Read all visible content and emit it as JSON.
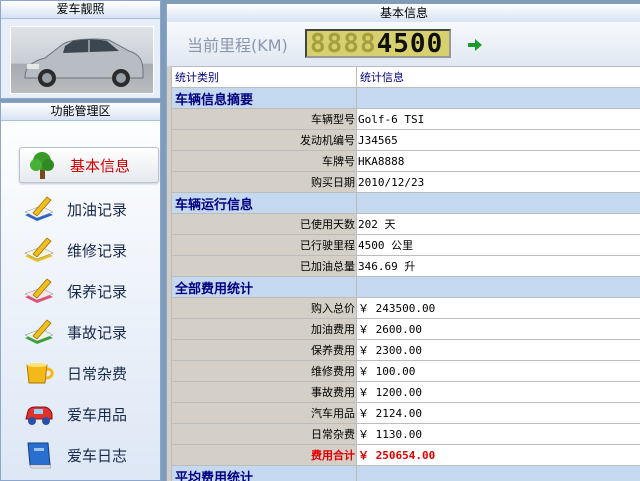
{
  "sidebar": {
    "car_title": "爱车靓照",
    "func_title": "功能管理区",
    "items": [
      {
        "label": "基本信息",
        "icon": "tree-icon",
        "active": true
      },
      {
        "label": "加油记录",
        "icon": "notepad-pen-icon"
      },
      {
        "label": "维修记录",
        "icon": "notepad-pen-icon"
      },
      {
        "label": "保养记录",
        "icon": "notepad-pen-icon"
      },
      {
        "label": "事故记录",
        "icon": "notepad-pen-icon"
      },
      {
        "label": "日常杂费",
        "icon": "cup-icon"
      },
      {
        "label": "爱车用品",
        "icon": "toy-car-icon"
      },
      {
        "label": "爱车日志",
        "icon": "book-icon"
      }
    ]
  },
  "main": {
    "title": "基本信息",
    "odometer_label": "当前里程(KM)",
    "odometer_ghost": "8888",
    "odometer_value": "4500",
    "columns": [
      "统计类别",
      "统计信息"
    ],
    "sections": [
      {
        "title": "车辆信息摘要",
        "rows": [
          {
            "k": "车辆型号",
            "v": "Golf-6 TSI"
          },
          {
            "k": "发动机编号",
            "v": "J34565"
          },
          {
            "k": "车牌号",
            "v": "HKA8888"
          },
          {
            "k": "购买日期",
            "v": "2010/12/23"
          }
        ]
      },
      {
        "title": "车辆运行信息",
        "rows": [
          {
            "k": "已使用天数",
            "v": "202 天"
          },
          {
            "k": "已行驶里程",
            "v": "4500 公里"
          },
          {
            "k": "已加油总量",
            "v": "346.69 升"
          }
        ]
      },
      {
        "title": "全部费用统计",
        "rows": [
          {
            "k": "购入总价",
            "v": "￥ 243500.00"
          },
          {
            "k": "加油费用",
            "v": "￥ 2600.00"
          },
          {
            "k": "保养费用",
            "v": "￥ 2300.00"
          },
          {
            "k": "维修费用",
            "v": "￥ 100.00"
          },
          {
            "k": "事故费用",
            "v": "￥ 1200.00"
          },
          {
            "k": "汽车用品",
            "v": "￥ 2124.00"
          },
          {
            "k": "日常杂费",
            "v": "￥ 1130.00"
          },
          {
            "k": "费用合计",
            "v": "￥ 250654.00",
            "total": true
          }
        ]
      },
      {
        "title": "平均费用统计",
        "rows": []
      }
    ]
  },
  "colors": {
    "accent_red": "#e00000",
    "section_bg": "#c4d8f0",
    "section_text": "#000080"
  }
}
